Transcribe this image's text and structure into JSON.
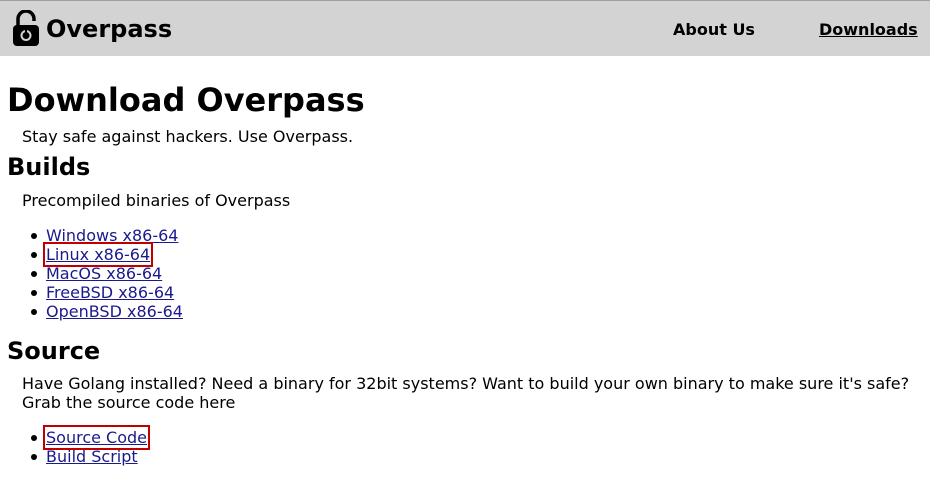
{
  "header": {
    "brand": "Overpass",
    "nav": {
      "about": "About Us",
      "downloads": "Downloads"
    }
  },
  "page": {
    "title": "Download Overpass",
    "tagline": "Stay safe against hackers. Use Overpass."
  },
  "builds": {
    "heading": "Builds",
    "description": "Precompiled binaries of Overpass",
    "items": [
      {
        "label": "Windows x86-64"
      },
      {
        "label": "Linux x86-64"
      },
      {
        "label": "MacOS x86-64"
      },
      {
        "label": "FreeBSD x86-64"
      },
      {
        "label": "OpenBSD x86-64"
      }
    ]
  },
  "source": {
    "heading": "Source",
    "description": "Have Golang installed? Need a binary for 32bit systems? Want to build your own binary to make sure it's safe? Grab the source code here",
    "items": [
      {
        "label": "Source Code"
      },
      {
        "label": "Build Script"
      }
    ]
  },
  "icons": {
    "logo": "padlock-icon"
  },
  "colors": {
    "header_bg": "#d3d3d3",
    "link": "#1a1a8c",
    "highlight": "#c00000"
  }
}
